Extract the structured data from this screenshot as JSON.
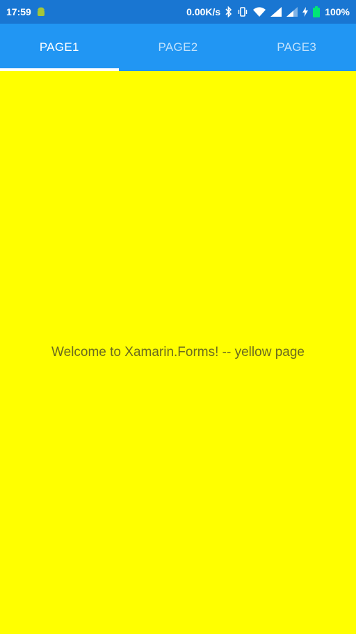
{
  "status_bar": {
    "time": "17:59",
    "network_speed": "0.00K/s",
    "battery_percent": "100%",
    "icons": [
      "android-icon",
      "bluetooth-icon",
      "vibrate-icon",
      "wifi-icon",
      "signal-icon",
      "signal-icon-2",
      "charging-icon",
      "battery-icon"
    ],
    "background_color": "#1976d2"
  },
  "tabs": [
    {
      "label": "PAGE1",
      "active": true
    },
    {
      "label": "PAGE2",
      "active": false
    },
    {
      "label": "PAGE3",
      "active": false
    }
  ],
  "tab_bar_color": "#2196f3",
  "content": {
    "welcome_text": "Welcome to Xamarin.Forms! -- yellow page",
    "background_color": "#ffff00"
  }
}
